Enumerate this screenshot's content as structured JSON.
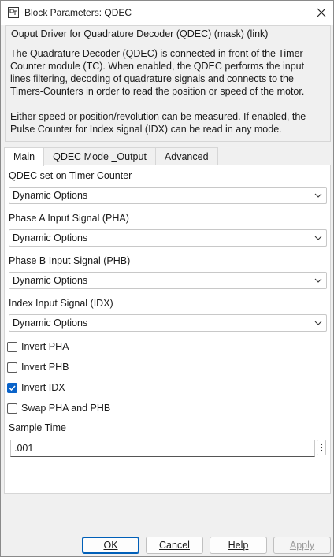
{
  "window": {
    "title": "Block Parameters: QDEC"
  },
  "description": {
    "header": "Ouput Driver for Quadrature Decoder (QDEC)  (mask) (link)",
    "lines_p1": [
      "The Quadrature Decoder (QDEC) is connected in front of the Timer-",
      "Counter module (TC). When enabled, the QDEC performs the input",
      "lines filtering, decoding of quadrature signals and connects to the",
      "Timers-Counters in order to read the position or speed of the motor."
    ],
    "lines_p2": [
      "Either speed or position/revolution can be measured. If enabled, the",
      "Pulse Counter for Index signal (IDX) can be read in any mode."
    ]
  },
  "tabs": [
    {
      "label_pre": "Main",
      "label_u": "",
      "label_post": ""
    },
    {
      "label_pre": "QDEC Mode ",
      "label_u": "_",
      "label_post": "Output"
    },
    {
      "label_pre": "Advanced",
      "label_u": "",
      "label_post": ""
    }
  ],
  "main": {
    "timer_counter": {
      "label": "QDEC set on Timer Counter",
      "value": "Dynamic Options"
    },
    "pha": {
      "label": "Phase A Input Signal (PHA)",
      "value": "Dynamic Options"
    },
    "phb": {
      "label": "Phase B Input Signal (PHB)",
      "value": "Dynamic Options"
    },
    "idx": {
      "label": "Index Input Signal (IDX)",
      "value": "Dynamic Options"
    },
    "checkboxes": [
      {
        "label": "Invert PHA",
        "checked": false
      },
      {
        "label": "Invert PHB",
        "checked": false
      },
      {
        "label": "Invert IDX",
        "checked": true
      },
      {
        "label": "Swap PHA and PHB",
        "checked": false
      }
    ],
    "sample_time": {
      "label": "Sample Time",
      "value": ".001"
    }
  },
  "buttons": {
    "ok": "OK",
    "cancel": "Cancel",
    "help": "Help",
    "apply": "Apply"
  },
  "colors": {
    "accent": "#0a63c9",
    "default_button_border": "#005fb8"
  }
}
